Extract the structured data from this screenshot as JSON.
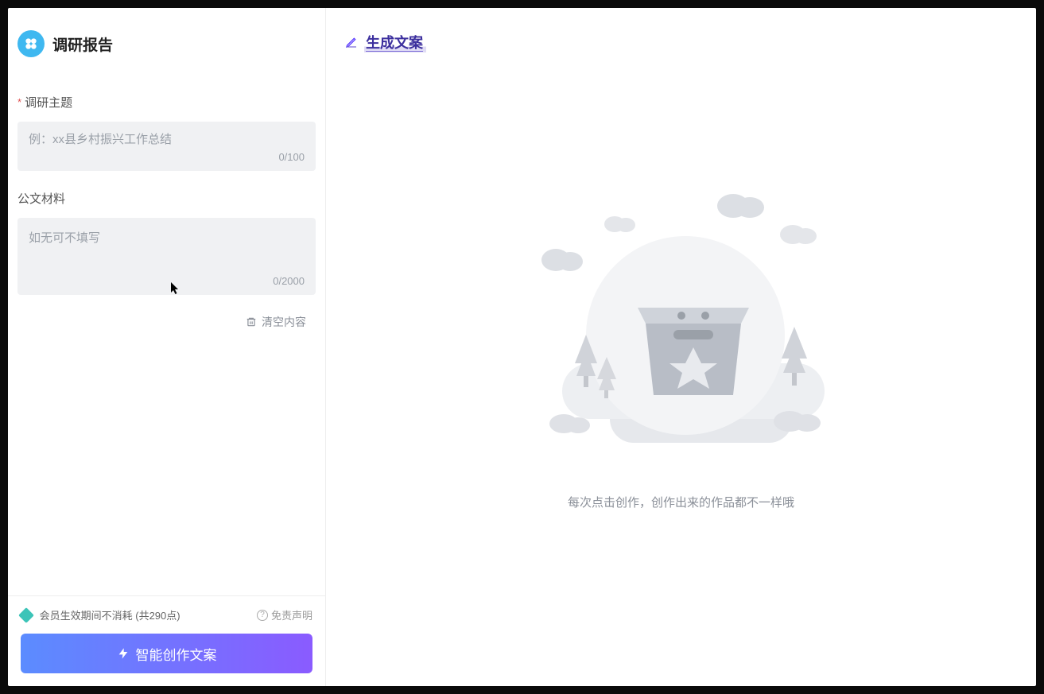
{
  "app": {
    "title": "调研报告"
  },
  "form": {
    "topic": {
      "label": "调研主题",
      "required": true,
      "placeholder": "例：xx县乡村振兴工作总结",
      "value": "",
      "counter": "0/100"
    },
    "material": {
      "label": "公文材料",
      "required": false,
      "placeholder": "如无可不填写",
      "value": "",
      "counter": "0/2000"
    },
    "clear_label": "清空内容"
  },
  "footer": {
    "credit_text": "会员生效期间不消耗 (共290点)",
    "disclaimer_label": "免责声明",
    "generate_button": "智能创作文案"
  },
  "right": {
    "title": "生成文案",
    "empty_caption": "每次点击创作，创作出来的作品都不一样哦"
  },
  "icons": {
    "logo": "app-logo",
    "pen": "pen-icon",
    "trash": "trash-icon",
    "bolt": "bolt-icon",
    "diamond": "diamond-icon",
    "question": "question-icon"
  },
  "colors": {
    "accent_start": "#5b8cff",
    "accent_end": "#8a5bff",
    "placeholder": "#9aa0a8",
    "logo_bg": "#3fb8f0"
  }
}
